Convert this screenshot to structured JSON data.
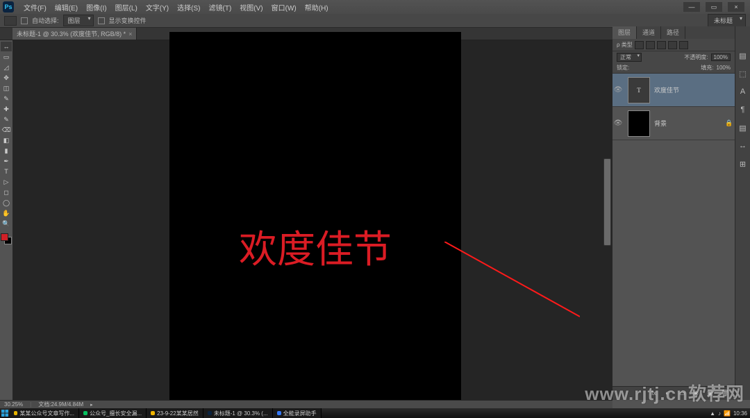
{
  "app": {
    "name": "Ps"
  },
  "menu": {
    "items": [
      "文件(F)",
      "编辑(E)",
      "图像(I)",
      "图层(L)",
      "文字(Y)",
      "选择(S)",
      "滤镜(T)",
      "视图(V)",
      "窗口(W)",
      "帮助(H)"
    ]
  },
  "window_controls": {
    "min": "—",
    "max": "▭",
    "close": "×"
  },
  "options": {
    "auto_select_label": "自动选择:",
    "auto_select_value": "图层",
    "show_transform_label": "显示变换控件",
    "workspace": "未标题"
  },
  "doc_tab": {
    "title": "未标题-1 @ 30.3% (欢度佳节, RGB/8) *"
  },
  "canvas": {
    "text": "欢度佳节",
    "text_color": "#db1c24",
    "annotation_line_color": "#ff1a1a"
  },
  "tools": [
    "↔",
    "▭",
    "◿",
    "✥",
    "◫",
    "✎",
    "✚",
    "✎",
    "⌫",
    "◧",
    "▮",
    "✒",
    "T",
    "▷",
    "◻",
    "◯",
    "✋",
    "🔍"
  ],
  "swatches": {
    "fg": "#d02027",
    "bg": "#000000"
  },
  "panels": {
    "tabs": [
      "图层",
      "通道",
      "路径"
    ],
    "filter_label": "ρ 类型",
    "blend_mode": "正常",
    "opacity_label": "不透明度:",
    "opacity_value": "100%",
    "lock_label": "锁定:",
    "fill_label": "填充:",
    "fill_value": "100%"
  },
  "layers": [
    {
      "visible": "👁",
      "type": "T",
      "name": "欢度佳节",
      "locked": "",
      "selected": true
    },
    {
      "visible": "👁",
      "type": "bg",
      "name": "背景",
      "locked": "🔒",
      "selected": false
    }
  ],
  "layers_footer_icons": [
    "fx",
    "◐",
    "▭",
    "◉",
    "▣",
    "🗑"
  ],
  "status": {
    "zoom": "30.25%",
    "doc_info": "文档:24.9M/4.84M"
  },
  "dock_icons": [
    "▤",
    "⬚",
    "A",
    "¶",
    "▤",
    "↔",
    "⊞"
  ],
  "taskbar": {
    "items": [
      {
        "color": "#e8b500",
        "label": "某某公众号文章写作..."
      },
      {
        "color": "#07c160",
        "label": "公众号_擅长安全漏..."
      },
      {
        "color": "#f0b400",
        "label": "23-9-22某某居然"
      },
      {
        "color": "#0a2340",
        "label": "未标题-1 @ 30.3% (..."
      },
      {
        "color": "#3478f6",
        "label": "全能录屏助手"
      }
    ],
    "clock": "10:36"
  },
  "watermark": "www.rjtj.cn软荐网"
}
